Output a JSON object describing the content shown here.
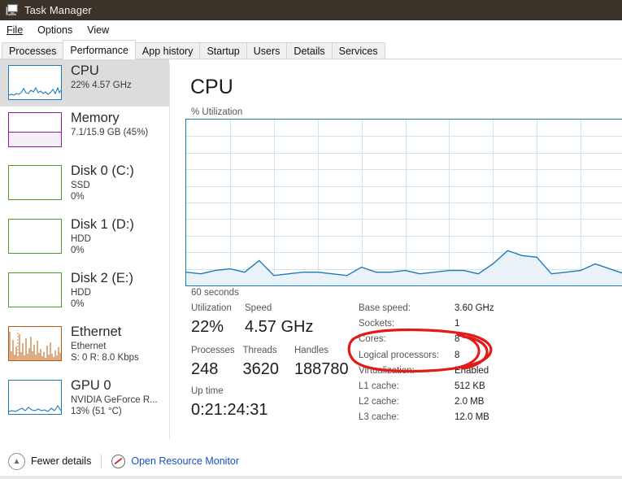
{
  "window": {
    "title": "Task Manager",
    "icon": "task-manager-monitor-icon"
  },
  "menu": {
    "items": [
      {
        "label": "File",
        "accel": "F"
      },
      {
        "label": "Options",
        "accel": "O"
      },
      {
        "label": "View",
        "accel": "V"
      }
    ]
  },
  "tabs": {
    "active": "Performance",
    "items": [
      {
        "label": "Processes"
      },
      {
        "label": "Performance"
      },
      {
        "label": "App history"
      },
      {
        "label": "Startup"
      },
      {
        "label": "Users"
      },
      {
        "label": "Details"
      },
      {
        "label": "Services"
      }
    ]
  },
  "sidebar": {
    "items": [
      {
        "name": "CPU",
        "line2": "22%  4.57 GHz",
        "line3": "",
        "selected": true,
        "color": "#1f7ab8",
        "graph": "line"
      },
      {
        "name": "Memory",
        "line2": "7.1/15.9 GB (45%)",
        "line3": "",
        "selected": false,
        "color": "#8b1d9e",
        "graph": "fill",
        "fill_percent": 45
      },
      {
        "name": "Disk 0 (C:)",
        "line2": "SSD",
        "line3": "0%",
        "selected": false,
        "color": "#4e9a22",
        "graph": "flat"
      },
      {
        "name": "Disk 1 (D:)",
        "line2": "HDD",
        "line3": "0%",
        "selected": false,
        "color": "#4e9a22",
        "graph": "flat"
      },
      {
        "name": "Disk 2 (E:)",
        "line2": "HDD",
        "line3": "0%",
        "selected": false,
        "color": "#4e9a22",
        "graph": "flat"
      },
      {
        "name": "Ethernet",
        "line2": "Ethernet",
        "line3": "S: 0 R: 8.0 Kbps",
        "selected": false,
        "color": "#b35a17",
        "graph": "spikes"
      },
      {
        "name": "GPU 0",
        "line2": "NVIDIA GeForce R...",
        "line3": "13%  (51 °C)",
        "selected": false,
        "color": "#1f7ab8",
        "graph": "line"
      }
    ]
  },
  "main": {
    "title": "CPU",
    "axis_label": "% Utilization",
    "time_label": "60 seconds",
    "stats": {
      "row1": [
        {
          "label": "Utilization",
          "value": "22%"
        },
        {
          "label": "Speed",
          "value": "4.57 GHz"
        }
      ],
      "row2": [
        {
          "label": "Processes",
          "value": "248"
        },
        {
          "label": "Threads",
          "value": "3620"
        },
        {
          "label": "Handles",
          "value": "188780"
        }
      ],
      "uptime": {
        "label": "Up time",
        "value": "0:21:24:31"
      }
    },
    "details": [
      {
        "key": "Base speed:",
        "value": "3.60 GHz"
      },
      {
        "key": "Sockets:",
        "value": "1"
      },
      {
        "key": "Cores:",
        "value": "8"
      },
      {
        "key": "Logical processors:",
        "value": "8"
      },
      {
        "key": "Virtualization:",
        "value": "Enabled"
      },
      {
        "key": "L1 cache:",
        "value": "512 KB"
      },
      {
        "key": "L2 cache:",
        "value": "2.0 MB"
      },
      {
        "key": "L3 cache:",
        "value": "12.0 MB"
      }
    ],
    "annotation": {
      "shape": "hand-drawn-ellipse",
      "color": "#e01b18",
      "targets": [
        "Cores:",
        "Logical processors:"
      ]
    }
  },
  "chart_data": {
    "type": "area",
    "title": "CPU % Utilization",
    "xlabel": "60 seconds",
    "ylabel": "% Utilization",
    "ylim": [
      0,
      100
    ],
    "grid": true,
    "line_color": "#1f7ab8",
    "fill_color": "#eaf2f9",
    "x": [
      0,
      2,
      4,
      6,
      8,
      10,
      12,
      14,
      16,
      18,
      20,
      22,
      24,
      26,
      28,
      30,
      32,
      34,
      36,
      38,
      40,
      42,
      44,
      46,
      48,
      50,
      52,
      54,
      56,
      58,
      60
    ],
    "values": [
      8,
      7,
      9,
      10,
      8,
      15,
      6,
      7,
      8,
      8,
      7,
      6,
      11,
      8,
      8,
      9,
      7,
      8,
      9,
      9,
      7,
      13,
      21,
      18,
      17,
      7,
      8,
      9,
      13,
      10,
      7
    ]
  },
  "bottombar": {
    "fewer_details": "Fewer details",
    "fewer_details_accel": "d",
    "resource_monitor": "Open Resource Monitor",
    "chevron": "chevron-up-icon"
  },
  "colors": {
    "titlebar": "#3b3229",
    "accent_blue": "#1f7ab8",
    "link": "#1a4fc4",
    "annotation_red": "#e01b18",
    "selected_row": "#dcdcdc"
  }
}
